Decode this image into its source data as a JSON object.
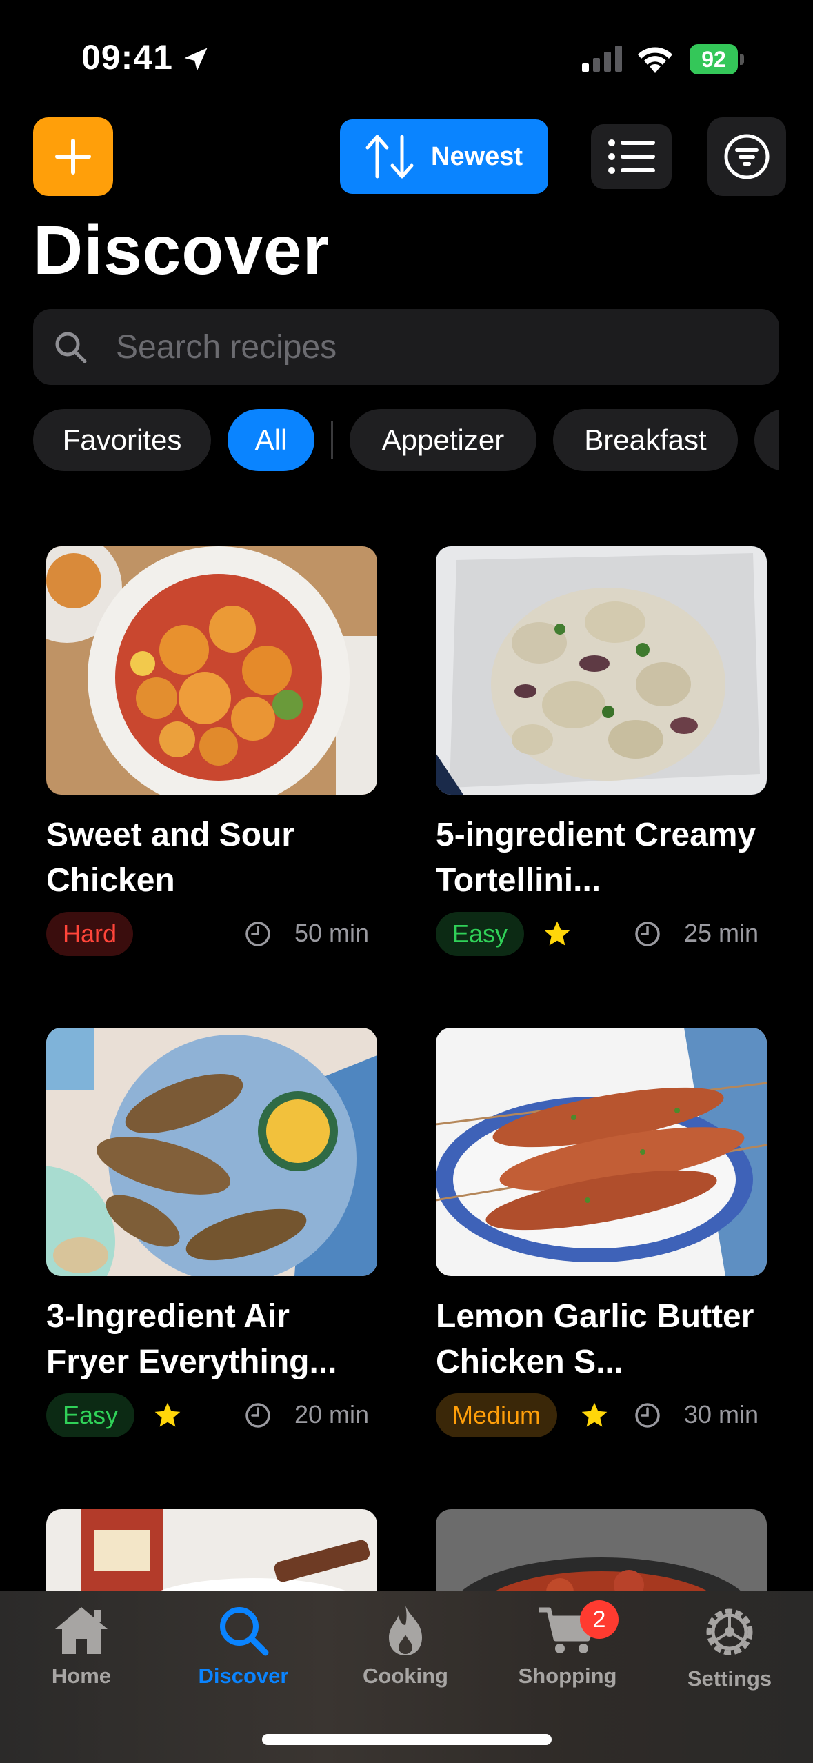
{
  "status_bar": {
    "time": "09:41",
    "battery": "92"
  },
  "toolbar": {
    "sort_label": "Newest"
  },
  "page_title": "Discover",
  "search": {
    "placeholder": "Search recipes"
  },
  "chips": [
    "Favorites",
    "All",
    "Appetizer",
    "Breakfast"
  ],
  "recipes": [
    {
      "title": "Sweet and Sour Chicken",
      "difficulty": "Hard",
      "favorite": false,
      "time": "50 min"
    },
    {
      "title": "5-ingredient Creamy Tortellini...",
      "difficulty": "Easy",
      "favorite": true,
      "time": "25 min"
    },
    {
      "title": "3-Ingredient Air Fryer Everything...",
      "difficulty": "Easy",
      "favorite": true,
      "time": "20 min"
    },
    {
      "title": "Lemon Garlic Butter Chicken S...",
      "difficulty": "Medium",
      "favorite": true,
      "time": "30 min"
    }
  ],
  "tabs": [
    {
      "label": "Home",
      "icon": "house-icon"
    },
    {
      "label": "Discover",
      "icon": "search-icon"
    },
    {
      "label": "Cooking",
      "icon": "flame-icon"
    },
    {
      "label": "Shopping",
      "icon": "cart-icon",
      "badge": "2"
    },
    {
      "label": "Settings",
      "icon": "gear-icon"
    }
  ],
  "colors": {
    "accent": "#0a84ff",
    "add_button": "#ff9f0a",
    "hard": "#ff453a",
    "easy": "#30d158",
    "medium": "#ff9f0a",
    "star": "#ffd60a"
  }
}
